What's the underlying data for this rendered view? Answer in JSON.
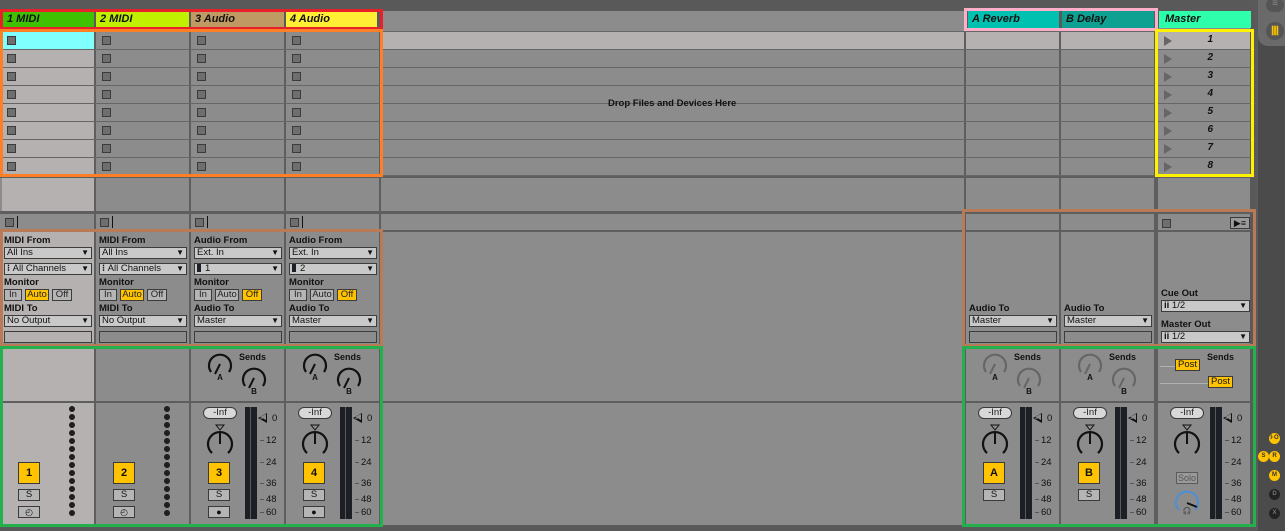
{
  "tracks": [
    {
      "title": "1 MIDI",
      "color": "#3fc000",
      "type": "midi",
      "number": "1",
      "input_label": "MIDI From",
      "input_source": "All Ins",
      "input_channel": "All Channels",
      "monitor_label": "Monitor",
      "monitor_options": [
        "In",
        "Auto",
        "Off"
      ],
      "monitor_active": "Auto",
      "output_label": "MIDI To",
      "output_target": "No Output",
      "solo_label": "S",
      "arm_icon": "clock-icon"
    },
    {
      "title": "2 MIDI",
      "color": "#c0f000",
      "type": "midi",
      "number": "2",
      "input_label": "MIDI From",
      "input_source": "All Ins",
      "input_channel": "All Channels",
      "monitor_label": "Monitor",
      "monitor_options": [
        "In",
        "Auto",
        "Off"
      ],
      "monitor_active": "Auto",
      "output_label": "MIDI To",
      "output_target": "No Output",
      "solo_label": "S",
      "arm_icon": "clock-icon"
    },
    {
      "title": "3 Audio",
      "color": "#c09a63",
      "type": "audio",
      "number": "3",
      "input_label": "Audio From",
      "input_source": "Ext. In",
      "input_channel": "1",
      "monitor_label": "Monitor",
      "monitor_options": [
        "In",
        "Auto",
        "Off"
      ],
      "monitor_active": "Off",
      "output_label": "Audio To",
      "output_target": "Master",
      "solo_label": "S",
      "arm_icon": "record-dot-icon",
      "volume": "-Inf",
      "sends_label": "Sends",
      "send_a": "A",
      "send_b": "B"
    },
    {
      "title": "4 Audio",
      "color": "#ffee33",
      "type": "audio",
      "number": "4",
      "input_label": "Audio From",
      "input_source": "Ext. In",
      "input_channel": "2",
      "monitor_label": "Monitor",
      "monitor_options": [
        "In",
        "Auto",
        "Off"
      ],
      "monitor_active": "Off",
      "output_label": "Audio To",
      "output_target": "Master",
      "solo_label": "S",
      "arm_icon": "record-dot-icon",
      "volume": "-Inf",
      "sends_label": "Sends",
      "send_a": "A",
      "send_b": "B"
    }
  ],
  "returns": [
    {
      "title": "A Reverb",
      "color": "#00c0b0",
      "letter": "A",
      "output_label": "Audio To",
      "output_target": "Master",
      "solo_label": "S",
      "volume": "-Inf",
      "sends_label": "Sends",
      "send_a": "A",
      "send_b": "B"
    },
    {
      "title": "B Delay",
      "color": "#0ea090",
      "letter": "B",
      "output_label": "Audio To",
      "output_target": "Master",
      "solo_label": "S",
      "volume": "-Inf",
      "sends_label": "Sends",
      "send_a": "A",
      "send_b": "B"
    }
  ],
  "master": {
    "title": "Master",
    "color": "#2dffaa",
    "scenes": [
      "1",
      "2",
      "3",
      "4",
      "5",
      "6",
      "7",
      "8"
    ],
    "cue_out_label": "Cue Out",
    "cue_out_value": "1/2",
    "master_out_label": "Master Out",
    "master_out_value": "1/2",
    "sends_label": "Sends",
    "post_a": "Post",
    "post_b": "Post",
    "volume": "-Inf",
    "solo_label": "Solo"
  },
  "drop_zone": {
    "text": "Drop Files and Devices Here"
  },
  "meter_scale": [
    "0",
    "12",
    "24",
    "36",
    "48",
    "60"
  ],
  "side_buttons": {
    "io": "I·O",
    "s": "S",
    "r": "R",
    "m": "M",
    "d": "D",
    "x": "X"
  },
  "highlights": {
    "track_titles": "#e8202a",
    "clip_slots": "#ff7f27",
    "return_titles": "#ffaec9",
    "scene_launch": "#fff200",
    "io_section": "#b97a57",
    "mixer_section": "#22b14c"
  }
}
